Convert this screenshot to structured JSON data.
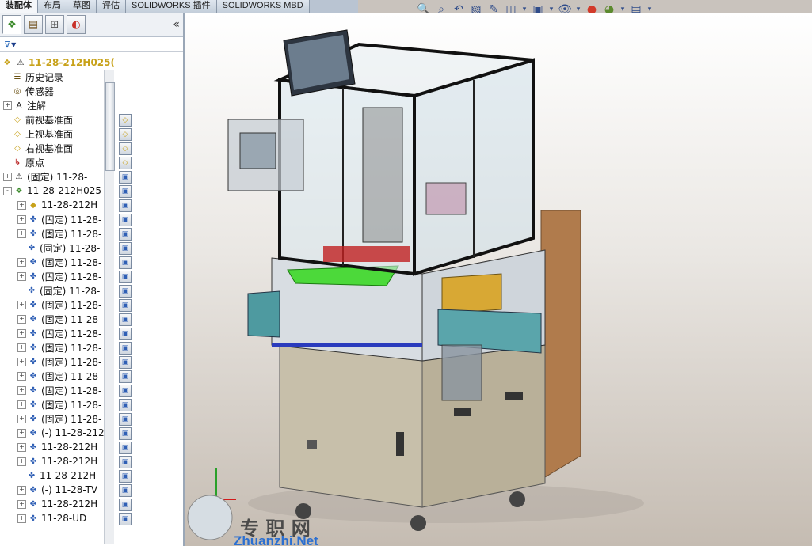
{
  "tabs": [
    "装配体",
    "布局",
    "草图",
    "评估",
    "SOLIDWORKS 插件",
    "SOLIDWORKS MBD"
  ],
  "active_tab": 0,
  "panel": {
    "collapse_symbol": "«",
    "filter_symbol": "▼",
    "root_label": "11-28-212H025(",
    "items": [
      {
        "label": "历史记录",
        "icon": "history-icon",
        "level": 1,
        "expander": ""
      },
      {
        "label": "传感器",
        "icon": "sensor-icon",
        "level": 1,
        "expander": ""
      },
      {
        "label": "注解",
        "icon": "annotation-icon",
        "level": 1,
        "expander": "+"
      },
      {
        "label": "前视基准面",
        "icon": "plane-icon",
        "level": 1,
        "expander": ""
      },
      {
        "label": "上视基准面",
        "icon": "plane-icon",
        "level": 1,
        "expander": ""
      },
      {
        "label": "右视基准面",
        "icon": "plane-icon",
        "level": 1,
        "expander": ""
      },
      {
        "label": "原点",
        "icon": "origin-icon",
        "level": 1,
        "expander": ""
      },
      {
        "label": "(固定) 11-28-",
        "icon": "warning-part-icon",
        "level": 1,
        "expander": "+"
      },
      {
        "label": "11-28-212H025",
        "icon": "assembly-icon",
        "level": 1,
        "expander": "-"
      },
      {
        "label": "11-28-212H",
        "icon": "part-icon",
        "level": 2,
        "expander": "+"
      },
      {
        "label": "(固定) 11-28-",
        "icon": "subassembly-icon",
        "level": 2,
        "expander": "+"
      },
      {
        "label": "(固定) 11-28-",
        "icon": "subassembly-icon",
        "level": 2,
        "expander": "+"
      },
      {
        "label": "(固定) 11-28-",
        "icon": "subassembly-icon",
        "level": 2,
        "expander": ""
      },
      {
        "label": "(固定) 11-28-",
        "icon": "subassembly-icon",
        "level": 2,
        "expander": "+"
      },
      {
        "label": "(固定) 11-28-",
        "icon": "subassembly-icon",
        "level": 2,
        "expander": "+"
      },
      {
        "label": "(固定) 11-28-",
        "icon": "subassembly-icon",
        "level": 2,
        "expander": ""
      },
      {
        "label": "(固定) 11-28-",
        "icon": "subassembly-icon",
        "level": 2,
        "expander": "+"
      },
      {
        "label": "(固定) 11-28-",
        "icon": "subassembly-icon",
        "level": 2,
        "expander": "+"
      },
      {
        "label": "(固定) 11-28-",
        "icon": "subassembly-icon",
        "level": 2,
        "expander": "+"
      },
      {
        "label": "(固定) 11-28-",
        "icon": "subassembly-icon",
        "level": 2,
        "expander": "+"
      },
      {
        "label": "(固定) 11-28-",
        "icon": "subassembly-icon",
        "level": 2,
        "expander": "+"
      },
      {
        "label": "(固定) 11-28-",
        "icon": "subassembly-icon",
        "level": 2,
        "expander": "+"
      },
      {
        "label": "(固定) 11-28-",
        "icon": "subassembly-icon",
        "level": 2,
        "expander": "+"
      },
      {
        "label": "(固定) 11-28-",
        "icon": "subassembly-icon",
        "level": 2,
        "expander": "+"
      },
      {
        "label": "(固定) 11-28-",
        "icon": "subassembly-icon",
        "level": 2,
        "expander": "+"
      },
      {
        "label": "(-) 11-28-212",
        "icon": "subassembly-icon",
        "level": 2,
        "expander": "+"
      },
      {
        "label": "11-28-212H",
        "icon": "subassembly-icon",
        "level": 2,
        "expander": "+"
      },
      {
        "label": "11-28-212H",
        "icon": "subassembly-icon",
        "level": 2,
        "expander": "+"
      },
      {
        "label": "11-28-212H",
        "icon": "subassembly-icon",
        "level": 2,
        "expander": ""
      },
      {
        "label": "(-) 11-28-TV",
        "icon": "subassembly-icon",
        "level": 2,
        "expander": "+"
      },
      {
        "label": "11-28-212H",
        "icon": "subassembly-icon",
        "level": 2,
        "expander": "+"
      },
      {
        "label": "11-28-UD",
        "icon": "subassembly-icon",
        "level": 2,
        "expander": "+"
      }
    ]
  },
  "watermark": {
    "chinese": "专 职 网",
    "latin": "Zhuanzhi.Net"
  }
}
